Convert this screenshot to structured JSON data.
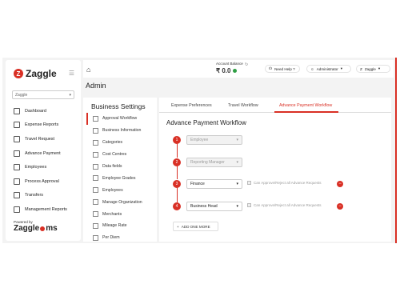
{
  "sidebar": {
    "logo": "Zaggle",
    "selector": "Zaggle",
    "items": [
      {
        "label": "Dashboard",
        "icon": "dashboard-icon"
      },
      {
        "label": "Expense Reports",
        "icon": "report-icon"
      },
      {
        "label": "Travel Request",
        "icon": "travel-icon"
      },
      {
        "label": "Advance Payment",
        "icon": "rupee-icon"
      },
      {
        "label": "Employees",
        "icon": "users-icon"
      },
      {
        "label": "Process Approval",
        "icon": "approval-icon"
      },
      {
        "label": "Transfers",
        "icon": "transfer-icon"
      },
      {
        "label": "Management Reports",
        "icon": "chart-icon"
      }
    ],
    "powered_by": "Powered by",
    "powered_brand_left": "Zaggle",
    "powered_brand_right": "ms"
  },
  "topbar": {
    "account_balance_label": "Account Balance",
    "account_balance_value": "₹ 0.0",
    "help": "Need Help ?",
    "role": "Administrator",
    "company_initial": "Z",
    "company": "Zaggle"
  },
  "page": {
    "title": "Admin"
  },
  "settings": {
    "title": "Business Settings",
    "items": [
      {
        "label": "Approval Workflow",
        "active": true
      },
      {
        "label": "Business Information"
      },
      {
        "label": "Categories"
      },
      {
        "label": "Cost Centres"
      },
      {
        "label": "Data fields"
      },
      {
        "label": "Employee Grades"
      },
      {
        "label": "Employees"
      },
      {
        "label": "Manage Organization"
      },
      {
        "label": "Merchants"
      },
      {
        "label": "Mileage Rate"
      },
      {
        "label": "Per Diem"
      }
    ]
  },
  "main": {
    "tabs": [
      "Expense Preferences",
      "Travel Workflow",
      "Advance Payment Workflow"
    ],
    "active_tab": 2,
    "title": "Advance Payment Workflow",
    "steps": [
      {
        "num": "1",
        "value": "Employee",
        "disabled": true
      },
      {
        "num": "2",
        "value": "Reporting Manager",
        "disabled": true
      },
      {
        "num": "3",
        "value": "Finance",
        "disabled": false,
        "approve": "Can Approve/Reject all Advance Requests"
      },
      {
        "num": "4",
        "value": "Business Head",
        "disabled": false,
        "approve": "Can Approve/Reject all Advance Requests"
      }
    ],
    "add_button": "ADD ONE MORE"
  },
  "colors": {
    "accent": "#d93025",
    "success": "#2e9e44"
  }
}
